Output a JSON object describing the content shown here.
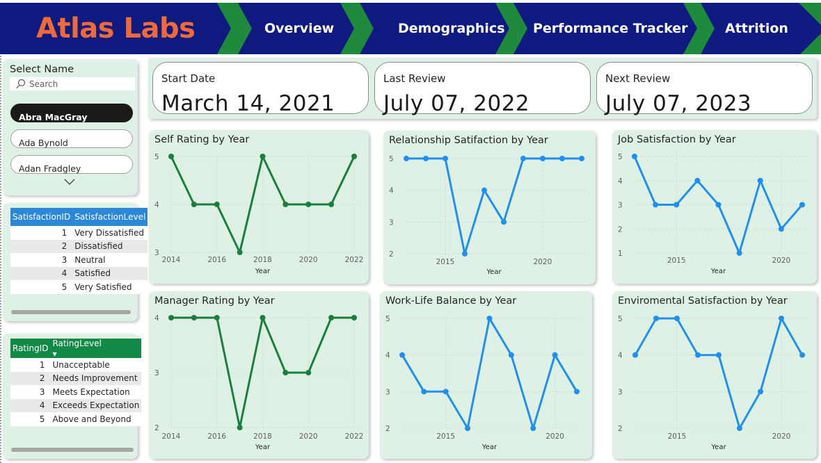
{
  "header": {
    "brand": "Atlas Labs",
    "nav": [
      "Overview",
      "Demographics",
      "Performance Tracker",
      "Attrition"
    ],
    "colors": {
      "bg": "#0e1a80",
      "chevron": "#1f8a3b",
      "brand": "#ef6a3a"
    }
  },
  "slicer": {
    "title": "Select Name",
    "search_placeholder": "Search",
    "items": [
      "Abra MacGray",
      "Ada Bynold",
      "Adan Fradgley"
    ],
    "selected": "Abra MacGray"
  },
  "satisfaction_table": {
    "headers": [
      "SatisfactionID",
      "SatisfactionLevel"
    ],
    "rows": [
      {
        "id": "1",
        "level": "Very Dissatisfied"
      },
      {
        "id": "2",
        "level": "Dissatisfied"
      },
      {
        "id": "3",
        "level": "Neutral"
      },
      {
        "id": "4",
        "level": "Satisfied"
      },
      {
        "id": "5",
        "level": "Very Satisfied"
      }
    ],
    "header_color": "#2b88d8"
  },
  "rating_table": {
    "headers": [
      "RatingID",
      "RatingLevel"
    ],
    "rows": [
      {
        "id": "1",
        "level": "Unacceptable"
      },
      {
        "id": "2",
        "level": "Needs Improvement"
      },
      {
        "id": "3",
        "level": "Meets Expectation"
      },
      {
        "id": "4",
        "level": "Exceeds Expectation"
      },
      {
        "id": "5",
        "level": "Above and Beyond"
      }
    ],
    "header_color": "#108a45"
  },
  "dates": {
    "start": {
      "label": "Start Date",
      "value": "March 14, 2021"
    },
    "last": {
      "label": "Last Review",
      "value": "July 07, 2022"
    },
    "next": {
      "label": "Next Review",
      "value": "July 07, 2023"
    }
  },
  "chart_data": [
    {
      "type": "line",
      "title": "Self Rating by Year",
      "xlabel": "Year",
      "ylabel": "",
      "color": "#1a7f3c",
      "x": [
        2014,
        2015,
        2016,
        2017,
        2018,
        2019,
        2020,
        2021,
        2022
      ],
      "values": [
        5,
        4,
        4,
        3,
        5,
        4,
        4,
        4,
        5
      ],
      "xticks": [
        2014,
        2016,
        2018,
        2020,
        2022
      ],
      "yticks": [
        3,
        4,
        5
      ],
      "xlim": [
        2014,
        2022
      ],
      "ylim": [
        3,
        5
      ],
      "grid": true
    },
    {
      "type": "line",
      "title": "Relationship Satifaction by Year",
      "xlabel": "Year",
      "ylabel": "",
      "color": "#1f8ff0",
      "x": [
        2013,
        2014,
        2015,
        2016,
        2017,
        2018,
        2019,
        2020,
        2021,
        2022
      ],
      "values": [
        5,
        5,
        5,
        2,
        4,
        3,
        5,
        5,
        5,
        5
      ],
      "xticks": [
        2015,
        2020
      ],
      "yticks": [
        2,
        3,
        4,
        5
      ],
      "xlim": [
        2013,
        2022
      ],
      "ylim": [
        2,
        5
      ],
      "grid": true
    },
    {
      "type": "line",
      "title": "Job Satisfaction by Year",
      "xlabel": "Year",
      "ylabel": "",
      "color": "#1f8ff0",
      "x": [
        2013,
        2014,
        2015,
        2016,
        2017,
        2018,
        2019,
        2020,
        2021,
        2022
      ],
      "values": [
        5,
        3,
        3,
        4,
        3,
        1,
        4,
        2,
        3,
        3
      ],
      "plot_values": [
        5,
        3,
        3,
        4,
        3,
        1,
        4,
        2,
        3
      ],
      "xticks": [
        2015,
        2020
      ],
      "yticks": [
        1,
        2,
        3,
        4,
        5
      ],
      "xlim": [
        2013,
        2021
      ],
      "ylim": [
        1,
        5
      ],
      "grid": true
    },
    {
      "type": "line",
      "title": "Manager Rating by Year",
      "xlabel": "Year",
      "ylabel": "",
      "color": "#1a7f3c",
      "x": [
        2014,
        2015,
        2016,
        2017,
        2018,
        2019,
        2020,
        2021,
        2022
      ],
      "values": [
        4,
        4,
        4,
        2,
        4,
        3,
        3,
        4,
        4
      ],
      "xticks": [
        2014,
        2016,
        2018,
        2020,
        2022
      ],
      "yticks": [
        2,
        3,
        4
      ],
      "xlim": [
        2014,
        2022
      ],
      "ylim": [
        2,
        4
      ],
      "grid": true
    },
    {
      "type": "line",
      "title": "Work-Life Balance by Year",
      "xlabel": "Year",
      "ylabel": "",
      "color": "#1f8ff0",
      "x": [
        2013,
        2014,
        2015,
        2016,
        2017,
        2018,
        2019,
        2020,
        2021,
        2022
      ],
      "values": [
        4,
        3,
        3,
        2,
        5,
        4,
        2,
        4,
        3,
        3
      ],
      "plot_values": [
        4,
        3,
        3,
        2,
        5,
        4,
        2,
        4,
        3
      ],
      "xticks": [
        2015,
        2020
      ],
      "yticks": [
        2,
        3,
        4,
        5
      ],
      "xlim": [
        2013,
        2021
      ],
      "ylim": [
        2,
        5
      ],
      "grid": true
    },
    {
      "type": "line",
      "title": "Enviromental Satisfaction by Year",
      "xlabel": "Year",
      "ylabel": "",
      "color": "#1f8ff0",
      "x": [
        2013,
        2014,
        2015,
        2016,
        2017,
        2018,
        2019,
        2020,
        2021,
        2022
      ],
      "values": [
        4,
        5,
        5,
        4,
        4,
        2,
        3,
        5,
        4,
        4
      ],
      "plot_values": [
        4,
        5,
        5,
        4,
        4,
        2,
        3,
        5,
        4
      ],
      "xticks": [
        2015,
        2020
      ],
      "yticks": [
        2,
        3,
        4,
        5
      ],
      "xlim": [
        2013,
        2021
      ],
      "ylim": [
        2,
        5
      ],
      "grid": true
    }
  ]
}
